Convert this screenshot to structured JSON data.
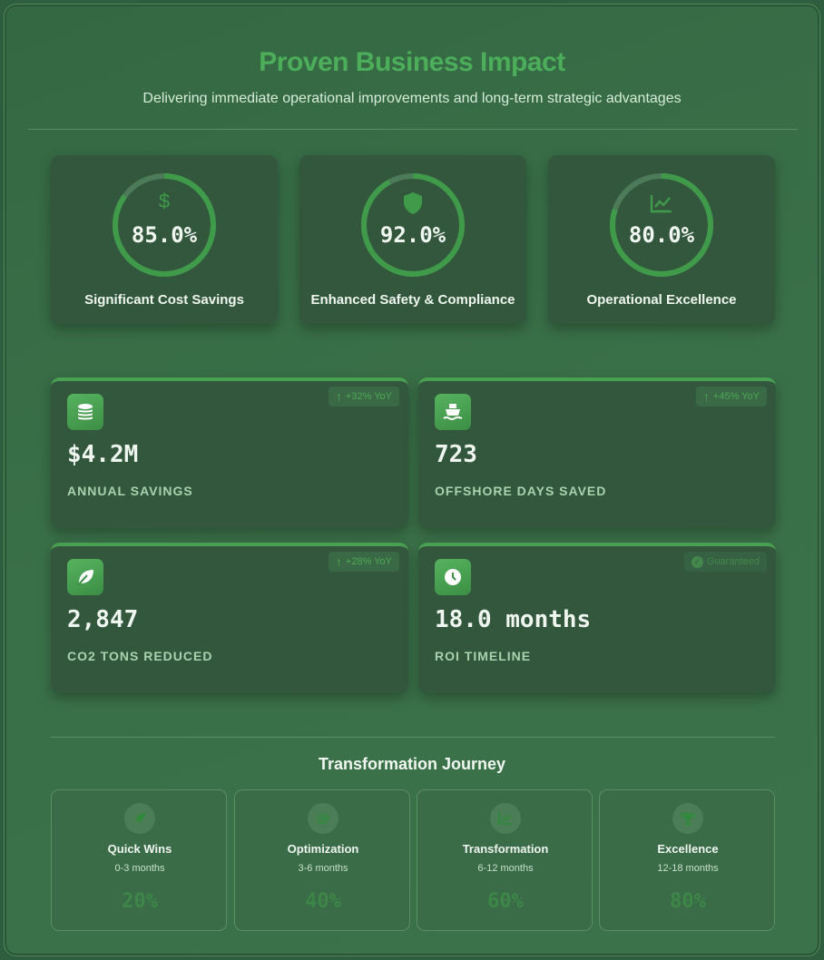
{
  "header": {
    "title": "Proven Business Impact",
    "subtitle": "Delivering immediate operational improvements and long-term strategic advantages"
  },
  "impact_circles": [
    {
      "icon": "dollar-icon",
      "value": "85.0%",
      "progress": 0.85,
      "label": "Significant Cost Savings"
    },
    {
      "icon": "shield-icon",
      "value": "92.0%",
      "progress": 0.92,
      "label": "Enhanced Safety & Compliance"
    },
    {
      "icon": "chart-line-icon",
      "value": "80.0%",
      "progress": 0.8,
      "label": "Operational Excellence"
    }
  ],
  "metrics": [
    {
      "icon": "coins-icon",
      "value": "$4.2M",
      "label": "ANNUAL SAVINGS",
      "badge": "+32% YoY",
      "badge_icon": "arrow-up-icon"
    },
    {
      "icon": "ship-icon",
      "value": "723",
      "label": "OFFSHORE DAYS SAVED",
      "badge": "+45% YoY",
      "badge_icon": "arrow-up-icon"
    },
    {
      "icon": "leaf-icon",
      "value": "2,847",
      "label": "CO2 TONS REDUCED",
      "badge": "+28% YoY",
      "badge_icon": "arrow-up-icon"
    },
    {
      "icon": "clock-icon",
      "value": "18.0 months",
      "label": "ROI TIMELINE",
      "badge": "Guaranteed",
      "badge_icon": "check-circle-icon"
    }
  ],
  "journey": {
    "title": "Transformation Journey",
    "phases": [
      {
        "icon": "rocket-icon",
        "name": "Quick Wins",
        "range": "0-3 months",
        "percent": "20%"
      },
      {
        "icon": "gear-icon",
        "name": "Optimization",
        "range": "3-6 months",
        "percent": "40%"
      },
      {
        "icon": "chart-line-icon",
        "name": "Transformation",
        "range": "6-12 months",
        "percent": "60%"
      },
      {
        "icon": "trophy-icon",
        "name": "Excellence",
        "range": "12-18 months",
        "percent": "80%"
      }
    ]
  },
  "colors": {
    "accent": "#4cae5a",
    "card_bg": "#32573d",
    "ring_track": "#4d7a58",
    "ring_fill": "#3f9a4a",
    "badge_text": "#4fa857"
  }
}
